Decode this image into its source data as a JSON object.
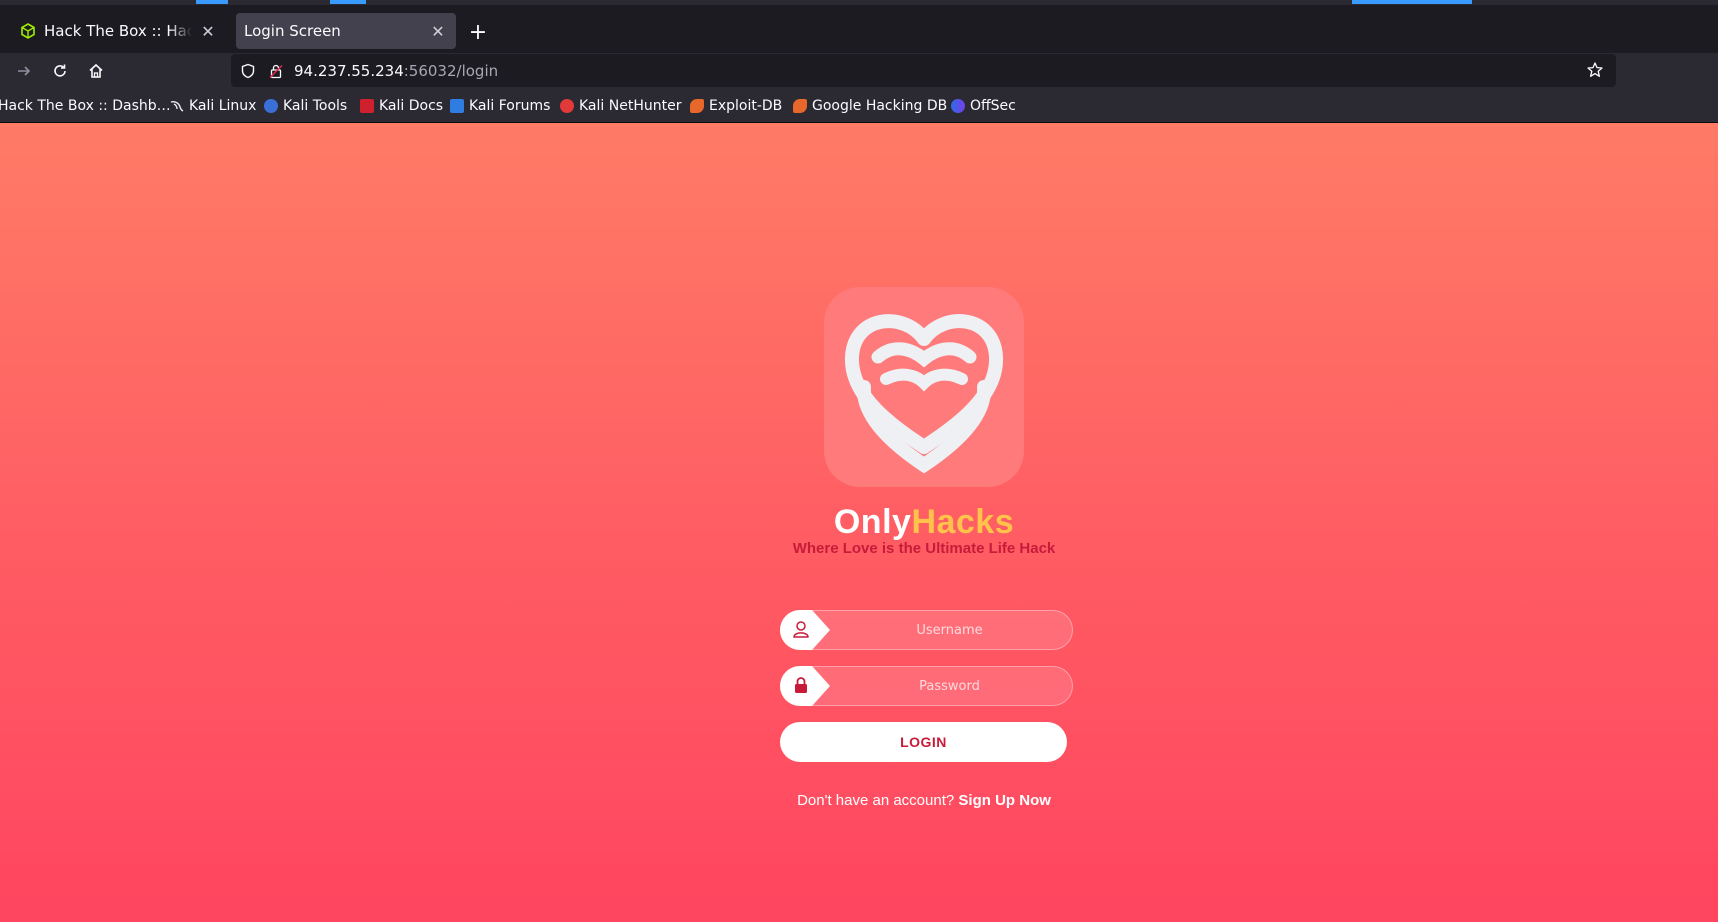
{
  "browser": {
    "tabs": [
      {
        "title": "Hack The Box :: Hack The Box",
        "active": false
      },
      {
        "title": "Login Screen",
        "active": true
      }
    ],
    "url": {
      "host": "94.237.55.234",
      "rest": ":56032/login"
    },
    "bookmarks": [
      {
        "label": "Hack The Box :: Dashb…",
        "icon": "htb-icon"
      },
      {
        "label": "Kali Linux",
        "icon": "kali-dragon-icon"
      },
      {
        "label": "Kali Tools",
        "icon": "kali-tools-icon"
      },
      {
        "label": "Kali Docs",
        "icon": "kali-docs-icon"
      },
      {
        "label": "Kali Forums",
        "icon": "kali-forums-icon"
      },
      {
        "label": "Kali NetHunter",
        "icon": "nethunter-icon"
      },
      {
        "label": "Exploit-DB",
        "icon": "exploit-db-icon"
      },
      {
        "label": "Google Hacking DB",
        "icon": "ghdb-icon"
      },
      {
        "label": "OffSec",
        "icon": "offsec-icon"
      }
    ]
  },
  "login": {
    "brand_part1": "Only",
    "brand_part2": "Hacks",
    "tagline": "Where Love is the Ultimate Life Hack",
    "username_placeholder": "Username",
    "password_placeholder": "Password",
    "login_label": "LOGIN",
    "signup_prompt": "Don't have an account?",
    "signup_link": "Sign Up Now"
  },
  "colors": {
    "gradient_top": "#ff7b66",
    "gradient_bottom": "#ff4560",
    "accent_red": "#c81b3a",
    "brand_yellow": "#ffc24a"
  }
}
